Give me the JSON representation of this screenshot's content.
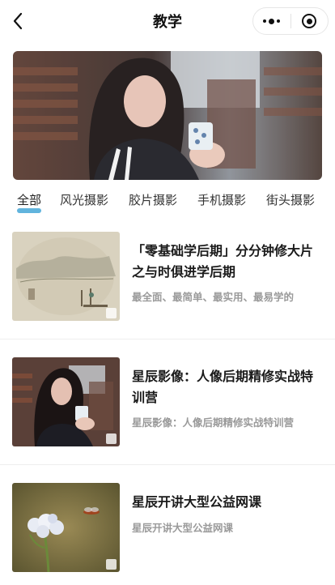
{
  "header": {
    "title": "教学",
    "back_icon": "chevron-left-icon",
    "menu_icon": "more-dots-icon",
    "close_icon": "target-circle-icon"
  },
  "banner": {
    "image": "girl-holding-cup-behind-window-photo"
  },
  "tabs": [
    {
      "label": "全部",
      "active": true
    },
    {
      "label": "风光摄影",
      "active": false
    },
    {
      "label": "胶片摄影",
      "active": false
    },
    {
      "label": "手机摄影",
      "active": false
    },
    {
      "label": "街头摄影",
      "active": false
    }
  ],
  "courses": [
    {
      "title": "「零基础学后期」分分钟修大片之与时俱进学后期",
      "subtitle": "最全面、最简单、最实用、最易学的",
      "thumb": "ink-landscape-painting-photo"
    },
    {
      "title": "星辰影像：人像后期精修实战特训营",
      "subtitle": "星辰影像：人像后期精修实战特训营",
      "thumb": "girl-portrait-photo"
    },
    {
      "title": "星辰开讲大型公益网课",
      "subtitle": "星辰开讲大型公益网课",
      "thumb": "white-flower-with-insect-photo"
    }
  ],
  "colors": {
    "tab_underline": "#45a7d7",
    "subtitle": "#9a9a9a",
    "title": "#1a1a1a"
  }
}
